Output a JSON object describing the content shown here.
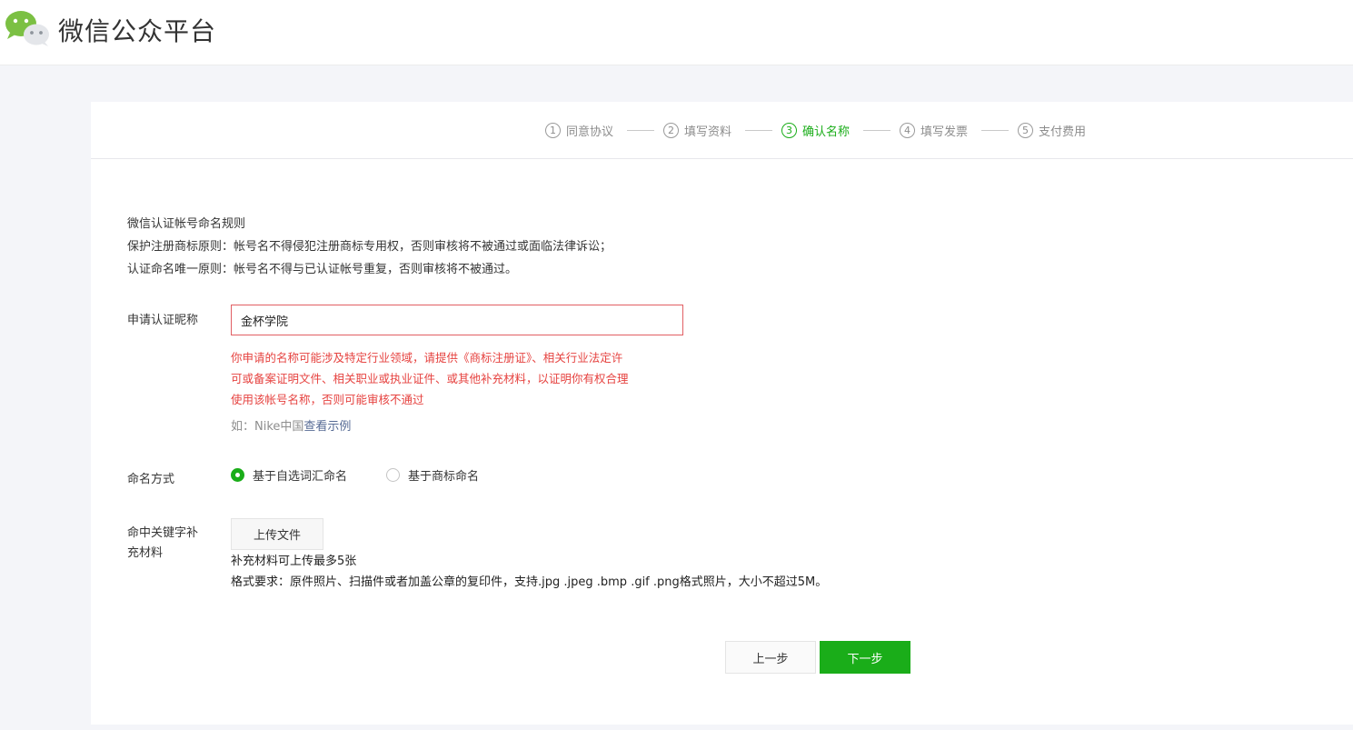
{
  "header": {
    "brand": "微信公众平台"
  },
  "steps": [
    {
      "num": "1",
      "label": "同意协议"
    },
    {
      "num": "2",
      "label": "填写资料"
    },
    {
      "num": "3",
      "label": "确认名称"
    },
    {
      "num": "4",
      "label": "填写发票"
    },
    {
      "num": "5",
      "label": "支付费用"
    }
  ],
  "active_step": "3",
  "rules": {
    "title": "微信认证帐号命名规则",
    "line1": "保护注册商标原则：帐号名不得侵犯注册商标专用权，否则审核将不被通过或面临法律诉讼；",
    "line2": "认证命名唯一原则：帐号名不得与已认证帐号重复，否则审核将不被通过。"
  },
  "nickname": {
    "label": "申请认证昵称",
    "value": "金杯学院",
    "warning_lines": [
      "你申请的名称可能涉及特定行业领域，请提供《商标注册证》、相关行业法定许",
      "可或备案证明文件、相关职业或执业证件、或其他补充材料，以证明你有权合理",
      "使用该帐号名称，否则可能审核不通过"
    ],
    "example_prefix": "如：Nike中国",
    "example_link": "查看示例"
  },
  "naming": {
    "label": "命名方式",
    "option1": "基于自选词汇命名",
    "option2": "基于商标命名",
    "selected": "基于自选词汇命名"
  },
  "upload": {
    "label_line1": "命中关键字补",
    "label_line2": "充材料",
    "button": "上传文件",
    "hint1": "补充材料可上传最多5张",
    "hint2": "格式要求：原件照片、扫描件或者加盖公章的复印件，支持.jpg .jpeg .bmp .gif .png格式照片，大小不超过5M。"
  },
  "footer": {
    "prev": "上一步",
    "next": "下一步"
  },
  "colors": {
    "accent": "#1aad19",
    "error": "#e64340",
    "link": "#576b95"
  }
}
